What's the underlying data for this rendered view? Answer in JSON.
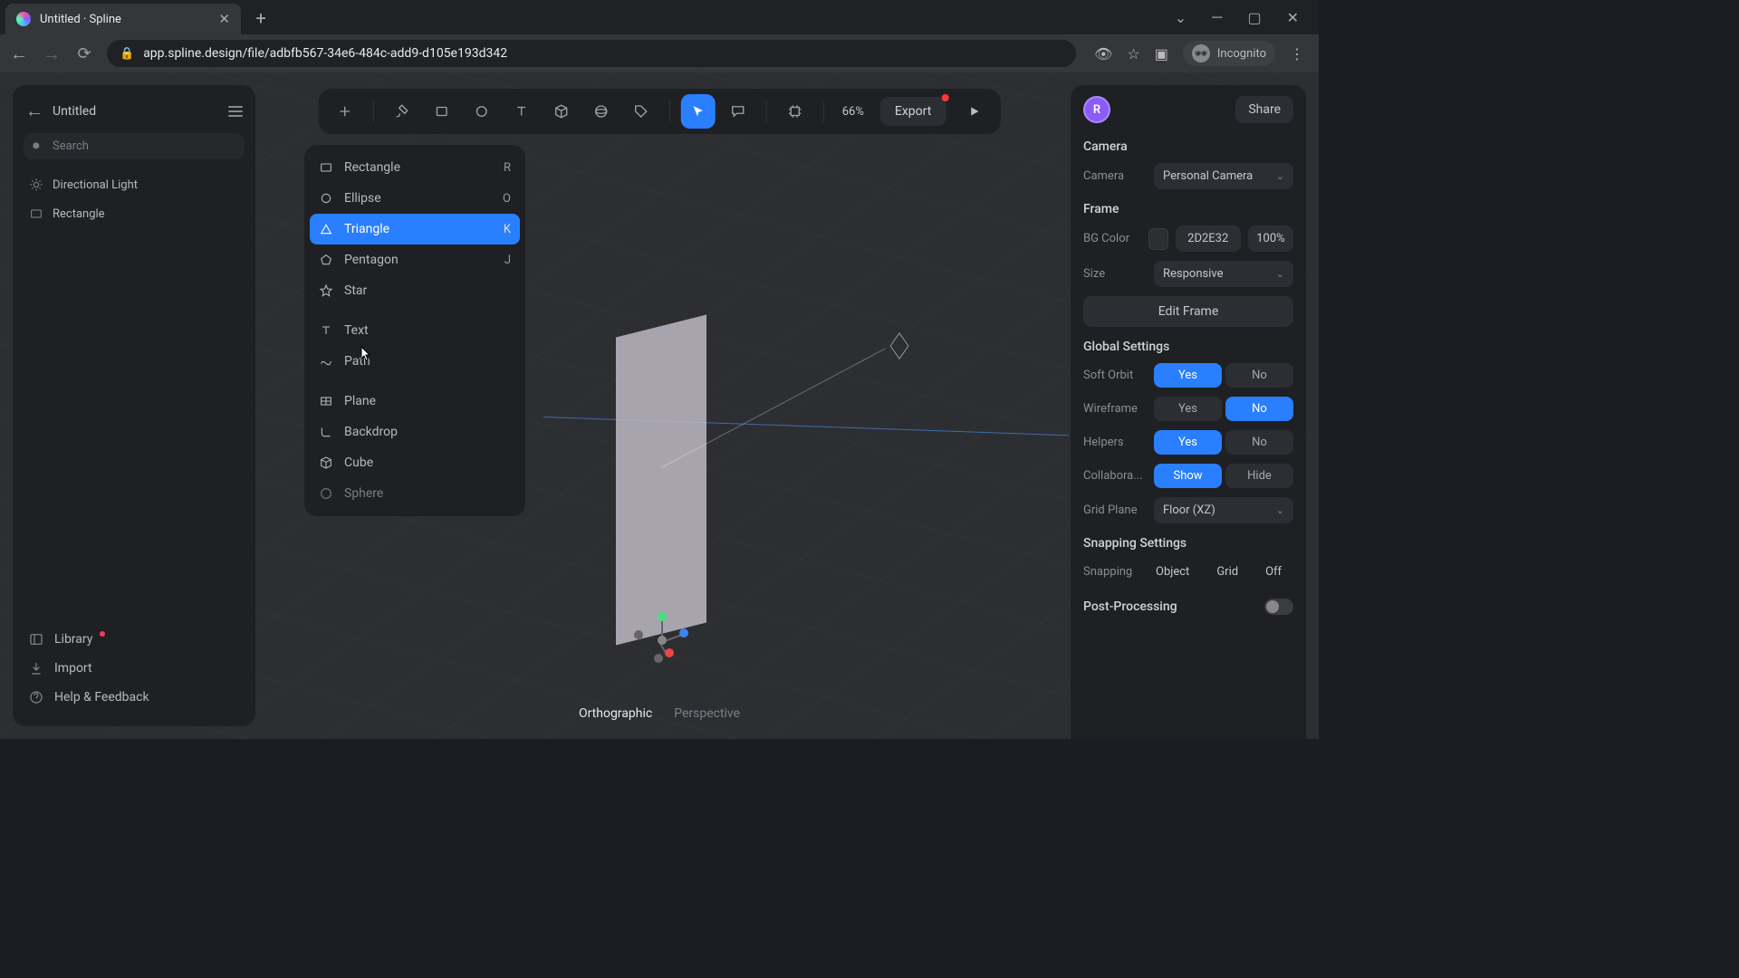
{
  "browser": {
    "tab_title": "Untitled · Spline",
    "url": "app.spline.design/file/adbfb567-34e6-484c-add9-d105e193d342",
    "incognito_label": "Incognito"
  },
  "left_panel": {
    "back_title": "Untitled",
    "search_placeholder": "Search",
    "layers": [
      {
        "name": "Directional Light",
        "icon": "light"
      },
      {
        "name": "Rectangle",
        "icon": "rect"
      }
    ],
    "library_label": "Library",
    "import_label": "Import",
    "help_label": "Help & Feedback"
  },
  "toolbar": {
    "zoom": "66%",
    "export_label": "Export"
  },
  "shape_menu": {
    "items": [
      {
        "label": "Rectangle",
        "shortcut": "R",
        "icon": "rect"
      },
      {
        "label": "Ellipse",
        "shortcut": "O",
        "icon": "ellipse"
      },
      {
        "label": "Triangle",
        "shortcut": "K",
        "icon": "triangle",
        "selected": true
      },
      {
        "label": "Pentagon",
        "shortcut": "J",
        "icon": "pentagon"
      },
      {
        "label": "Star",
        "shortcut": "",
        "icon": "star"
      }
    ],
    "items2": [
      {
        "label": "Text",
        "icon": "text"
      },
      {
        "label": "Path",
        "icon": "path"
      }
    ],
    "items3": [
      {
        "label": "Plane",
        "icon": "plane"
      },
      {
        "label": "Backdrop",
        "icon": "backdrop"
      },
      {
        "label": "Cube",
        "icon": "cube"
      },
      {
        "label": "Sphere",
        "icon": "sphere"
      }
    ]
  },
  "projection": {
    "ortho": "Orthographic",
    "persp": "Perspective",
    "active": "ortho"
  },
  "right_panel": {
    "avatar_letter": "R",
    "share_label": "Share",
    "camera": {
      "title": "Camera",
      "label": "Camera",
      "value": "Personal Camera"
    },
    "frame": {
      "title": "Frame",
      "bg_label": "BG Color",
      "bg_hex": "2D2E32",
      "bg_opacity": "100%",
      "size_label": "Size",
      "size_value": "Responsive",
      "edit_label": "Edit Frame"
    },
    "global": {
      "title": "Global Settings",
      "soft_orbit": "Soft Orbit",
      "wireframe": "Wireframe",
      "helpers": "Helpers",
      "collab": "Collabora...",
      "grid_plane_label": "Grid Plane",
      "grid_plane_value": "Floor (XZ)",
      "yes": "Yes",
      "no": "No",
      "show": "Show",
      "hide": "Hide"
    },
    "snapping": {
      "title": "Snapping Settings",
      "label": "Snapping",
      "object": "Object",
      "grid": "Grid",
      "off": "Off"
    },
    "post": {
      "title": "Post-Processing"
    }
  }
}
